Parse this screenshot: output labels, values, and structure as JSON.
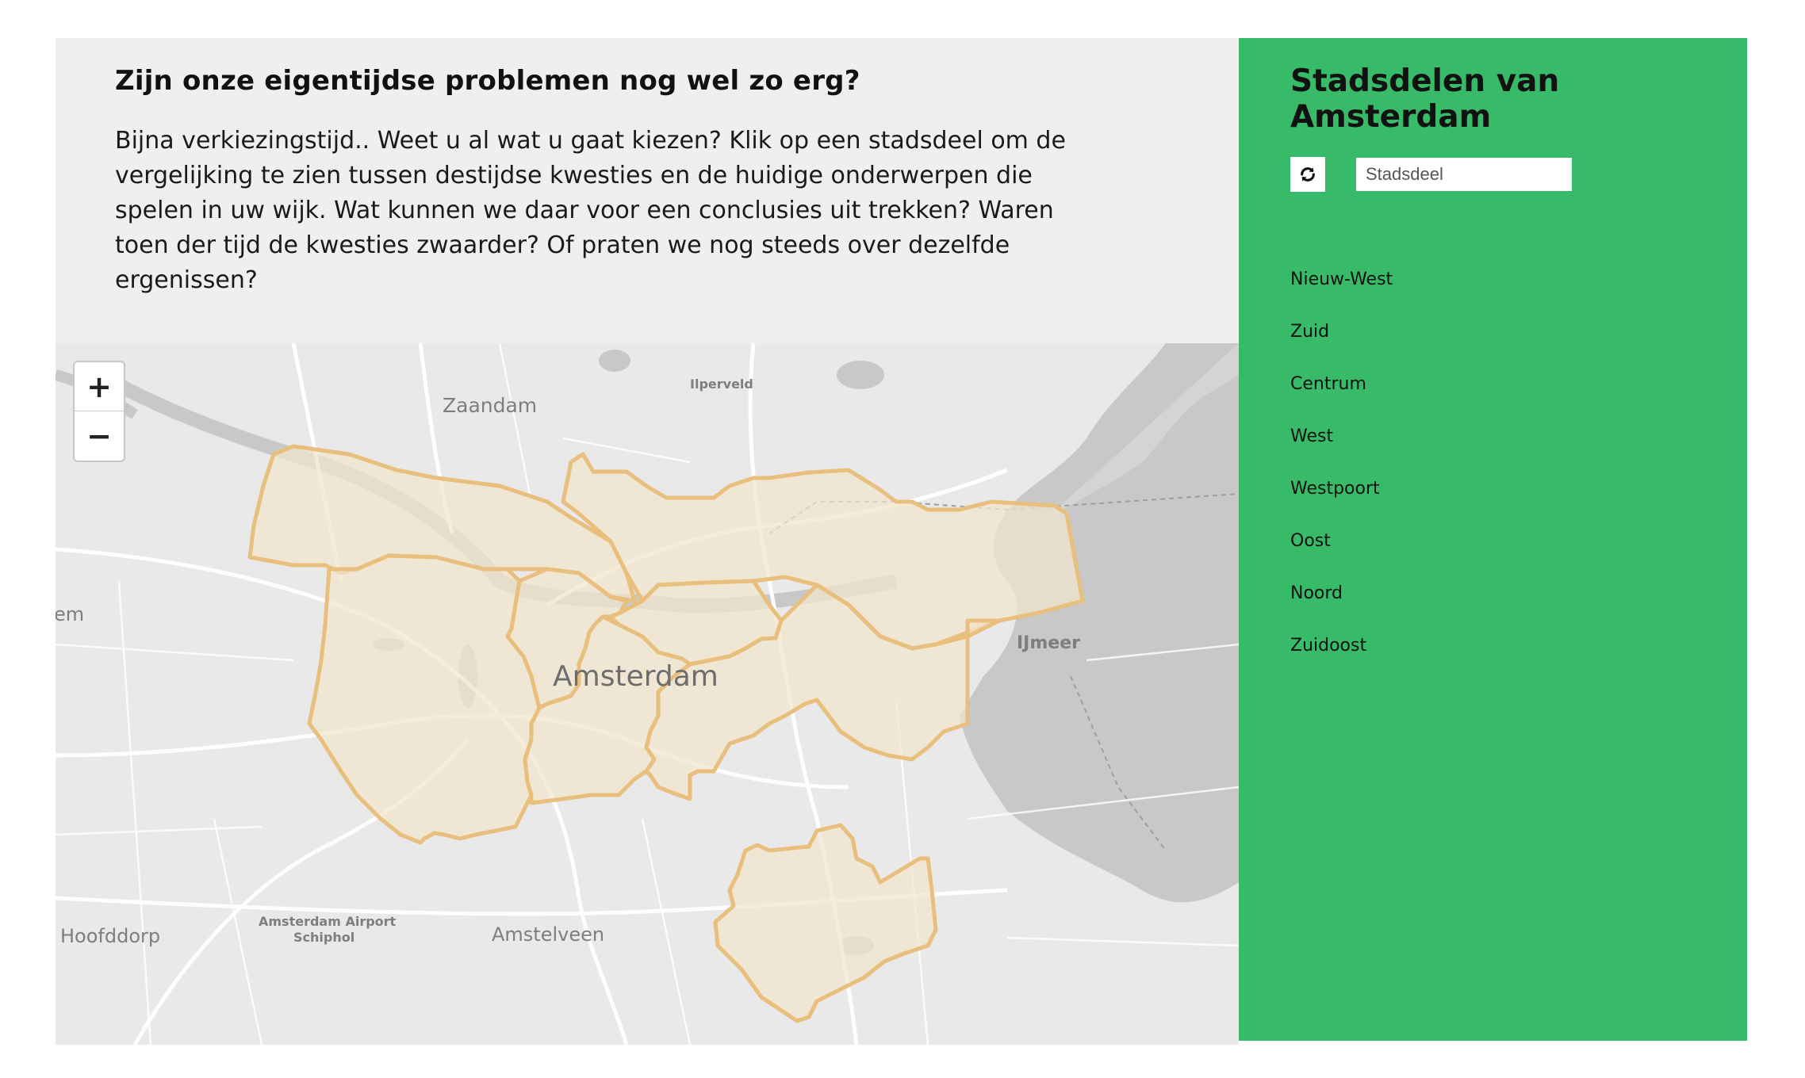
{
  "intro": {
    "title": "Zijn onze eigentijdse problemen nog wel zo erg?",
    "body": "Bijna verkiezingstijd.. Weet u al wat u gaat kiezen? Klik op een stadsdeel om de vergelijking te zien tussen destijdse kwesties en de huidige onderwerpen die spelen in uw wijk. Wat kunnen we daar voor een conclusies uit trekken? Waren toen der tijd de kwesties zwaarder? Of praten we nog steeds over dezelfde ergenissen?"
  },
  "map": {
    "zoom_in": "+",
    "zoom_out": "−",
    "labels": {
      "zaandam": "Zaandam",
      "ilperveld": "Ilperveld",
      "amsterdam": "Amsterdam",
      "ijmeer": "IJmeer",
      "hoofddorp": "Hoofddorp",
      "airport_line1": "Amsterdam Airport",
      "airport_line2": "Schiphol",
      "amstelveen": "Amstelveen",
      "haarlem_partial": "em"
    },
    "colors": {
      "district_fill": "#f3e4cc",
      "district_stroke": "#e8bf7d",
      "water": "#c8c8c8",
      "land": "#e9e9e9"
    }
  },
  "sidebar": {
    "title": "Stadsdelen van Amsterdam",
    "refresh_icon": "refresh-icon",
    "search_placeholder": "Stadsdeel",
    "districts": [
      "Nieuw-West",
      "Zuid",
      "Centrum",
      "West",
      "Westpoort",
      "Oost",
      "Noord",
      "Zuidoost"
    ],
    "background": "#37bb69"
  }
}
